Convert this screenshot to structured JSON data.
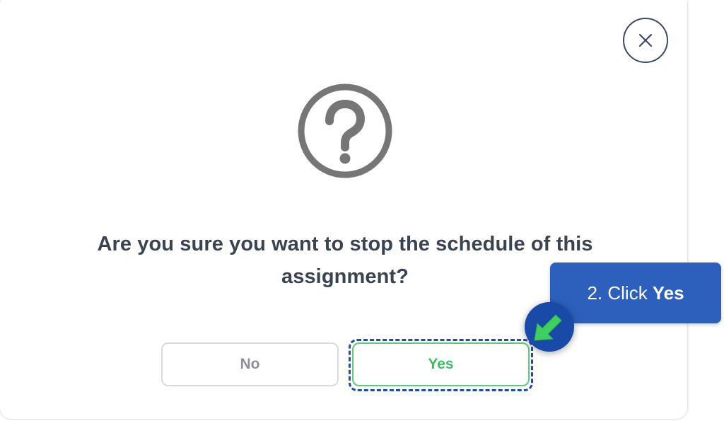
{
  "dialog": {
    "message": "Are you sure you want to stop the schedule of this assignment?",
    "icons": {
      "close": "close-icon",
      "main": "question-circle-icon"
    },
    "buttons": {
      "no_label": "No",
      "yes_label": "Yes"
    }
  },
  "guide": {
    "step_prefix": "2. Click",
    "step_target": "Yes",
    "pointer_icon": "arrow-pointer-icon"
  },
  "colors": {
    "yes_accent": "#3bbf61",
    "guide_blue": "#2d5fbc",
    "highlight_blue": "#1f4ea8",
    "pointer_green": "#3fcf5e"
  }
}
